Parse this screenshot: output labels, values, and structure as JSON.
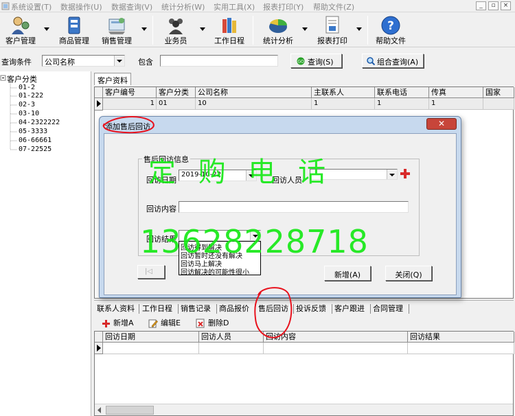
{
  "menu": {
    "items": [
      "系统设置(T)",
      "数据操作(U)",
      "数据查询(V)",
      "统计分析(W)",
      "实用工具(X)",
      "报表打印(Y)",
      "帮助文件(Z)"
    ],
    "window_buttons": [
      "_",
      "▫",
      "×"
    ]
  },
  "toolbar": {
    "customer": "客户管理",
    "product": "商品管理",
    "sales": "销售管理",
    "salesman": "业务员",
    "schedule": "工作日程",
    "stats": "统计分析",
    "report": "报表打印",
    "help": "帮助文件"
  },
  "query": {
    "condition_label": "查询条件",
    "field_value": "公司名称",
    "contains_label": "包含",
    "keyword_value": "",
    "query_button": "查询(S)",
    "combo_query_button": "组合查询(A)"
  },
  "tree": {
    "root": "客户分类",
    "items": [
      "01-2",
      "01-222",
      "02-3",
      "03-10",
      "04-2322222",
      "05-3333",
      "06-66661",
      "07-22525"
    ]
  },
  "customer_panel": {
    "tab": "客户资料",
    "columns": [
      "客户编号",
      "客户分类",
      "公司名称",
      "主联系人",
      "联系电话",
      "传真",
      "国家"
    ],
    "rows": [
      [
        "1",
        "01",
        "10",
        "1",
        "1",
        "1",
        ""
      ]
    ]
  },
  "dialog": {
    "title": "添加售后回访",
    "close_symbol": "✕",
    "group_title": "售后回访信息",
    "date_label": "回访日期",
    "date_value": "2019-10-22",
    "staff_label": "回访人员",
    "staff_value": "",
    "content_label": "回访内容",
    "content_value": "",
    "result_label": "回访结果",
    "result_value": "",
    "result_options": [
      "回访得到解决",
      "回访暂时还没有解决",
      "回访马上解决",
      "回访解决的可能性很小"
    ],
    "first_record_symbol": "|◁",
    "new_button": "新增(A)",
    "close_button": "关闭(Q)"
  },
  "watermark": {
    "line1": "定 购 电 话",
    "line2": "13628228718"
  },
  "bottom_tabs": [
    "联系人资料",
    "工作日程",
    "销售记录",
    "商品报价",
    "售后回访",
    "投诉反馈",
    "客户跟进",
    "合同管理"
  ],
  "bottom_toolbar": {
    "add": "新增A",
    "edit": "编辑E",
    "delete": "删除D"
  },
  "followup_grid": {
    "columns": [
      "回访日期",
      "回访人员",
      "回访内容",
      "回访结果"
    ]
  },
  "colors": {
    "annotation_red": "#e8111c",
    "watermark_green": "#16e916",
    "dialog_frame": "#c7d9ee"
  }
}
